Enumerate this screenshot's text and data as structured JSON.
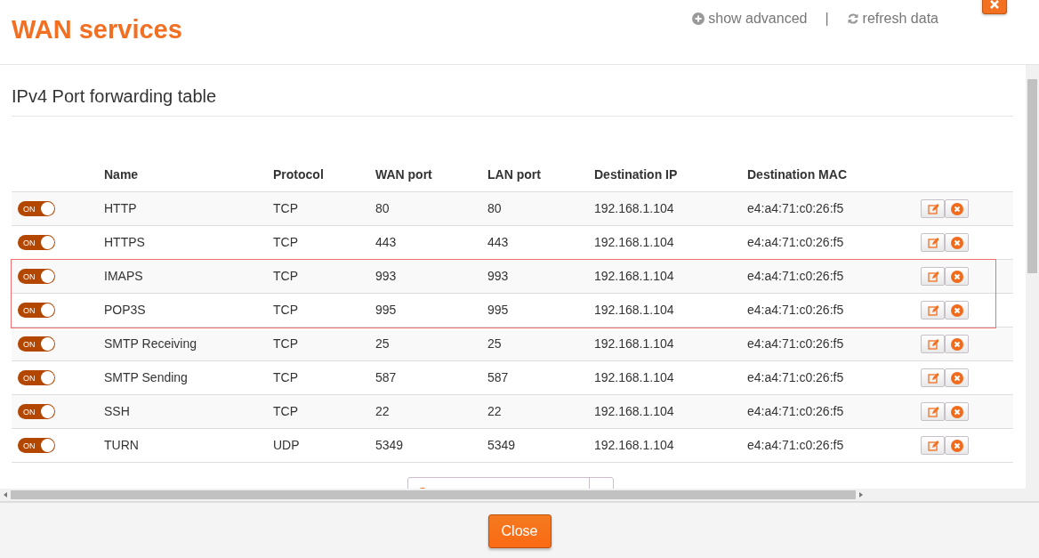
{
  "dialog": {
    "title": "WAN services",
    "links": [
      {
        "kind": "advanced",
        "label": "show advanced"
      },
      {
        "kind": "refresh",
        "label": "refresh data"
      }
    ],
    "separator": "|"
  },
  "section": {
    "title": "IPv4 Port forwarding table"
  },
  "table": {
    "columns": [
      "Name",
      "Protocol",
      "WAN port",
      "LAN port",
      "Destination IP",
      "Destination MAC"
    ],
    "rows": [
      {
        "on": true,
        "toggle_label": "ON",
        "highlighted": false,
        "cells": [
          "HTTP",
          "TCP",
          "80",
          "80",
          "192.168.1.104",
          "e4:a4:71:c0:26:f5"
        ]
      },
      {
        "on": true,
        "toggle_label": "ON",
        "highlighted": false,
        "cells": [
          "HTTPS",
          "TCP",
          "443",
          "443",
          "192.168.1.104",
          "e4:a4:71:c0:26:f5"
        ]
      },
      {
        "on": true,
        "toggle_label": "ON",
        "highlighted": true,
        "cells": [
          "IMAPS",
          "TCP",
          "993",
          "993",
          "192.168.1.104",
          "e4:a4:71:c0:26:f5"
        ]
      },
      {
        "on": true,
        "toggle_label": "ON",
        "highlighted": true,
        "cells": [
          "POP3S",
          "TCP",
          "995",
          "995",
          "192.168.1.104",
          "e4:a4:71:c0:26:f5"
        ]
      },
      {
        "on": true,
        "toggle_label": "ON",
        "highlighted": false,
        "cells": [
          "SMTP Receiving",
          "TCP",
          "25",
          "25",
          "192.168.1.104",
          "e4:a4:71:c0:26:f5"
        ]
      },
      {
        "on": true,
        "toggle_label": "ON",
        "highlighted": false,
        "cells": [
          "SMTP Sending",
          "TCP",
          "587",
          "587",
          "192.168.1.104",
          "e4:a4:71:c0:26:f5"
        ]
      },
      {
        "on": true,
        "toggle_label": "ON",
        "highlighted": false,
        "cells": [
          "SSH",
          "TCP",
          "22",
          "22",
          "192.168.1.104",
          "e4:a4:71:c0:26:f5"
        ]
      },
      {
        "on": true,
        "toggle_label": "ON",
        "highlighted": false,
        "cells": [
          "TURN",
          "UDP",
          "5349",
          "5349",
          "192.168.1.104",
          "e4:a4:71:c0:26:f5"
        ]
      }
    ]
  },
  "footer": {
    "button": "Close"
  }
}
